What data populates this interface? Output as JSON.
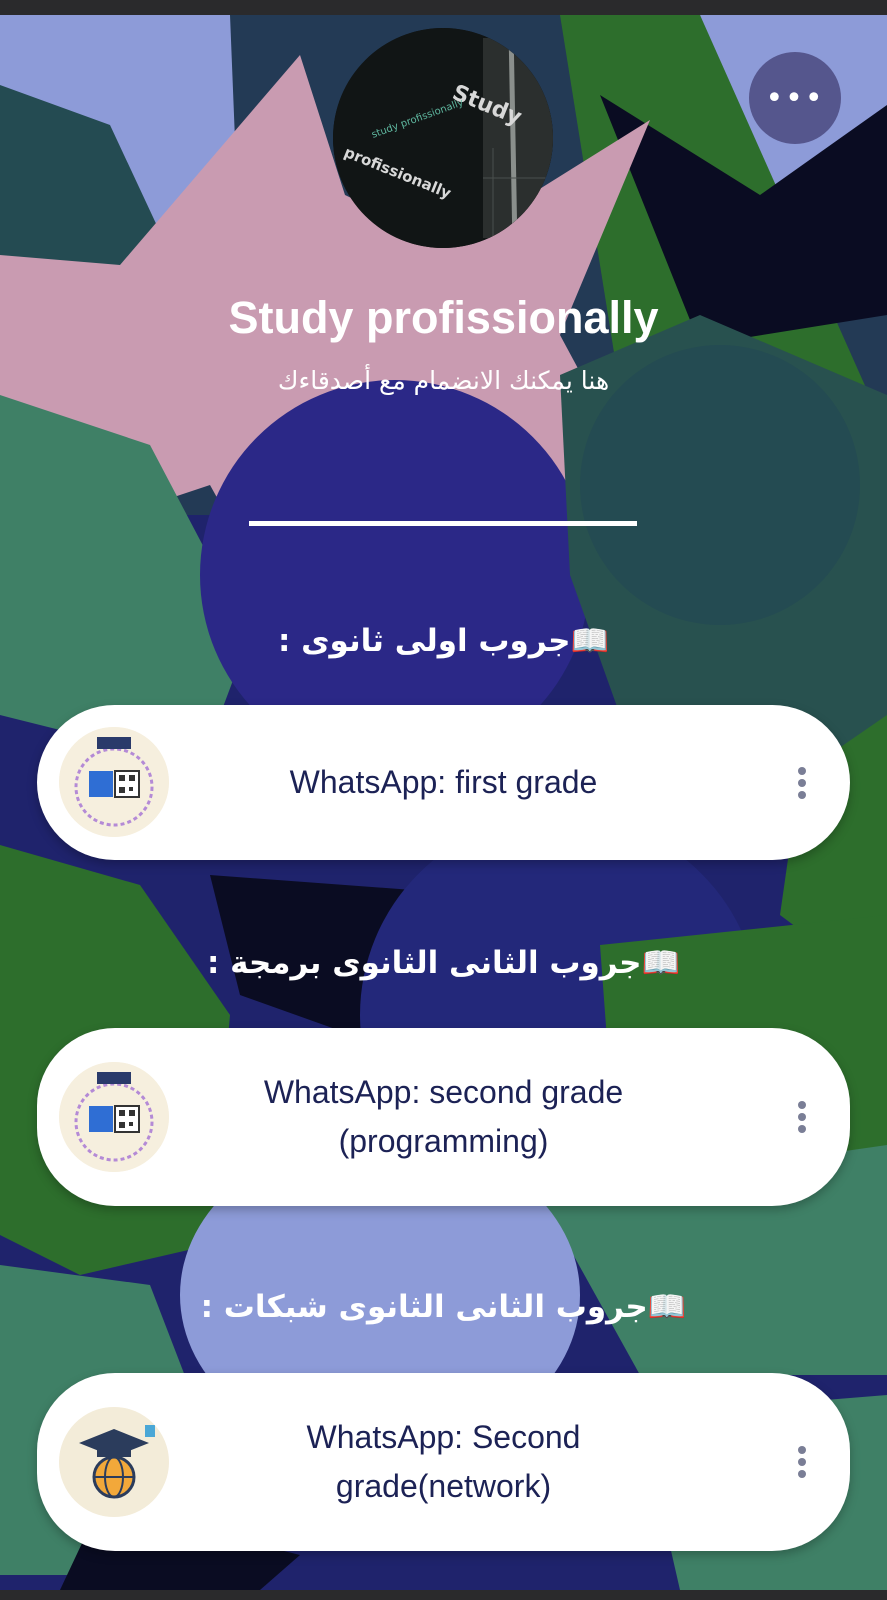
{
  "header": {
    "more_label": "•••",
    "avatar_icon": "study-logo-image",
    "avatar_text_top": "Study",
    "avatar_text_mid": "study profissionally",
    "avatar_text_bottom": "profissionally",
    "title": "Study profissionally",
    "subtitle": "هنا يمكنك الانضمام مع أصدقاءك"
  },
  "sections": [
    {
      "heading": "📖جروب اولى ثانوى :",
      "link": {
        "label": "WhatsApp: first grade",
        "icon": "qr-code-badge-icon"
      }
    },
    {
      "heading": "📖جروب الثانى الثانوى برمجة :",
      "link": {
        "label": "WhatsApp: second grade (programming)",
        "icon": "qr-code-badge-icon"
      }
    },
    {
      "heading": "📖جروب الثانى الثانوى شبكات :",
      "link": {
        "label": "WhatsApp: Second grade(network)",
        "icon": "graduation-globe-icon"
      }
    }
  ],
  "colors": {
    "card_text": "#1c2255",
    "card_bg": "#ffffff",
    "background_navy": "#1f236c",
    "background_pink": "#c99bb1",
    "background_green": "#2d6e2c",
    "background_teal": "#3f8066",
    "background_lavender": "#8d9bd8"
  }
}
